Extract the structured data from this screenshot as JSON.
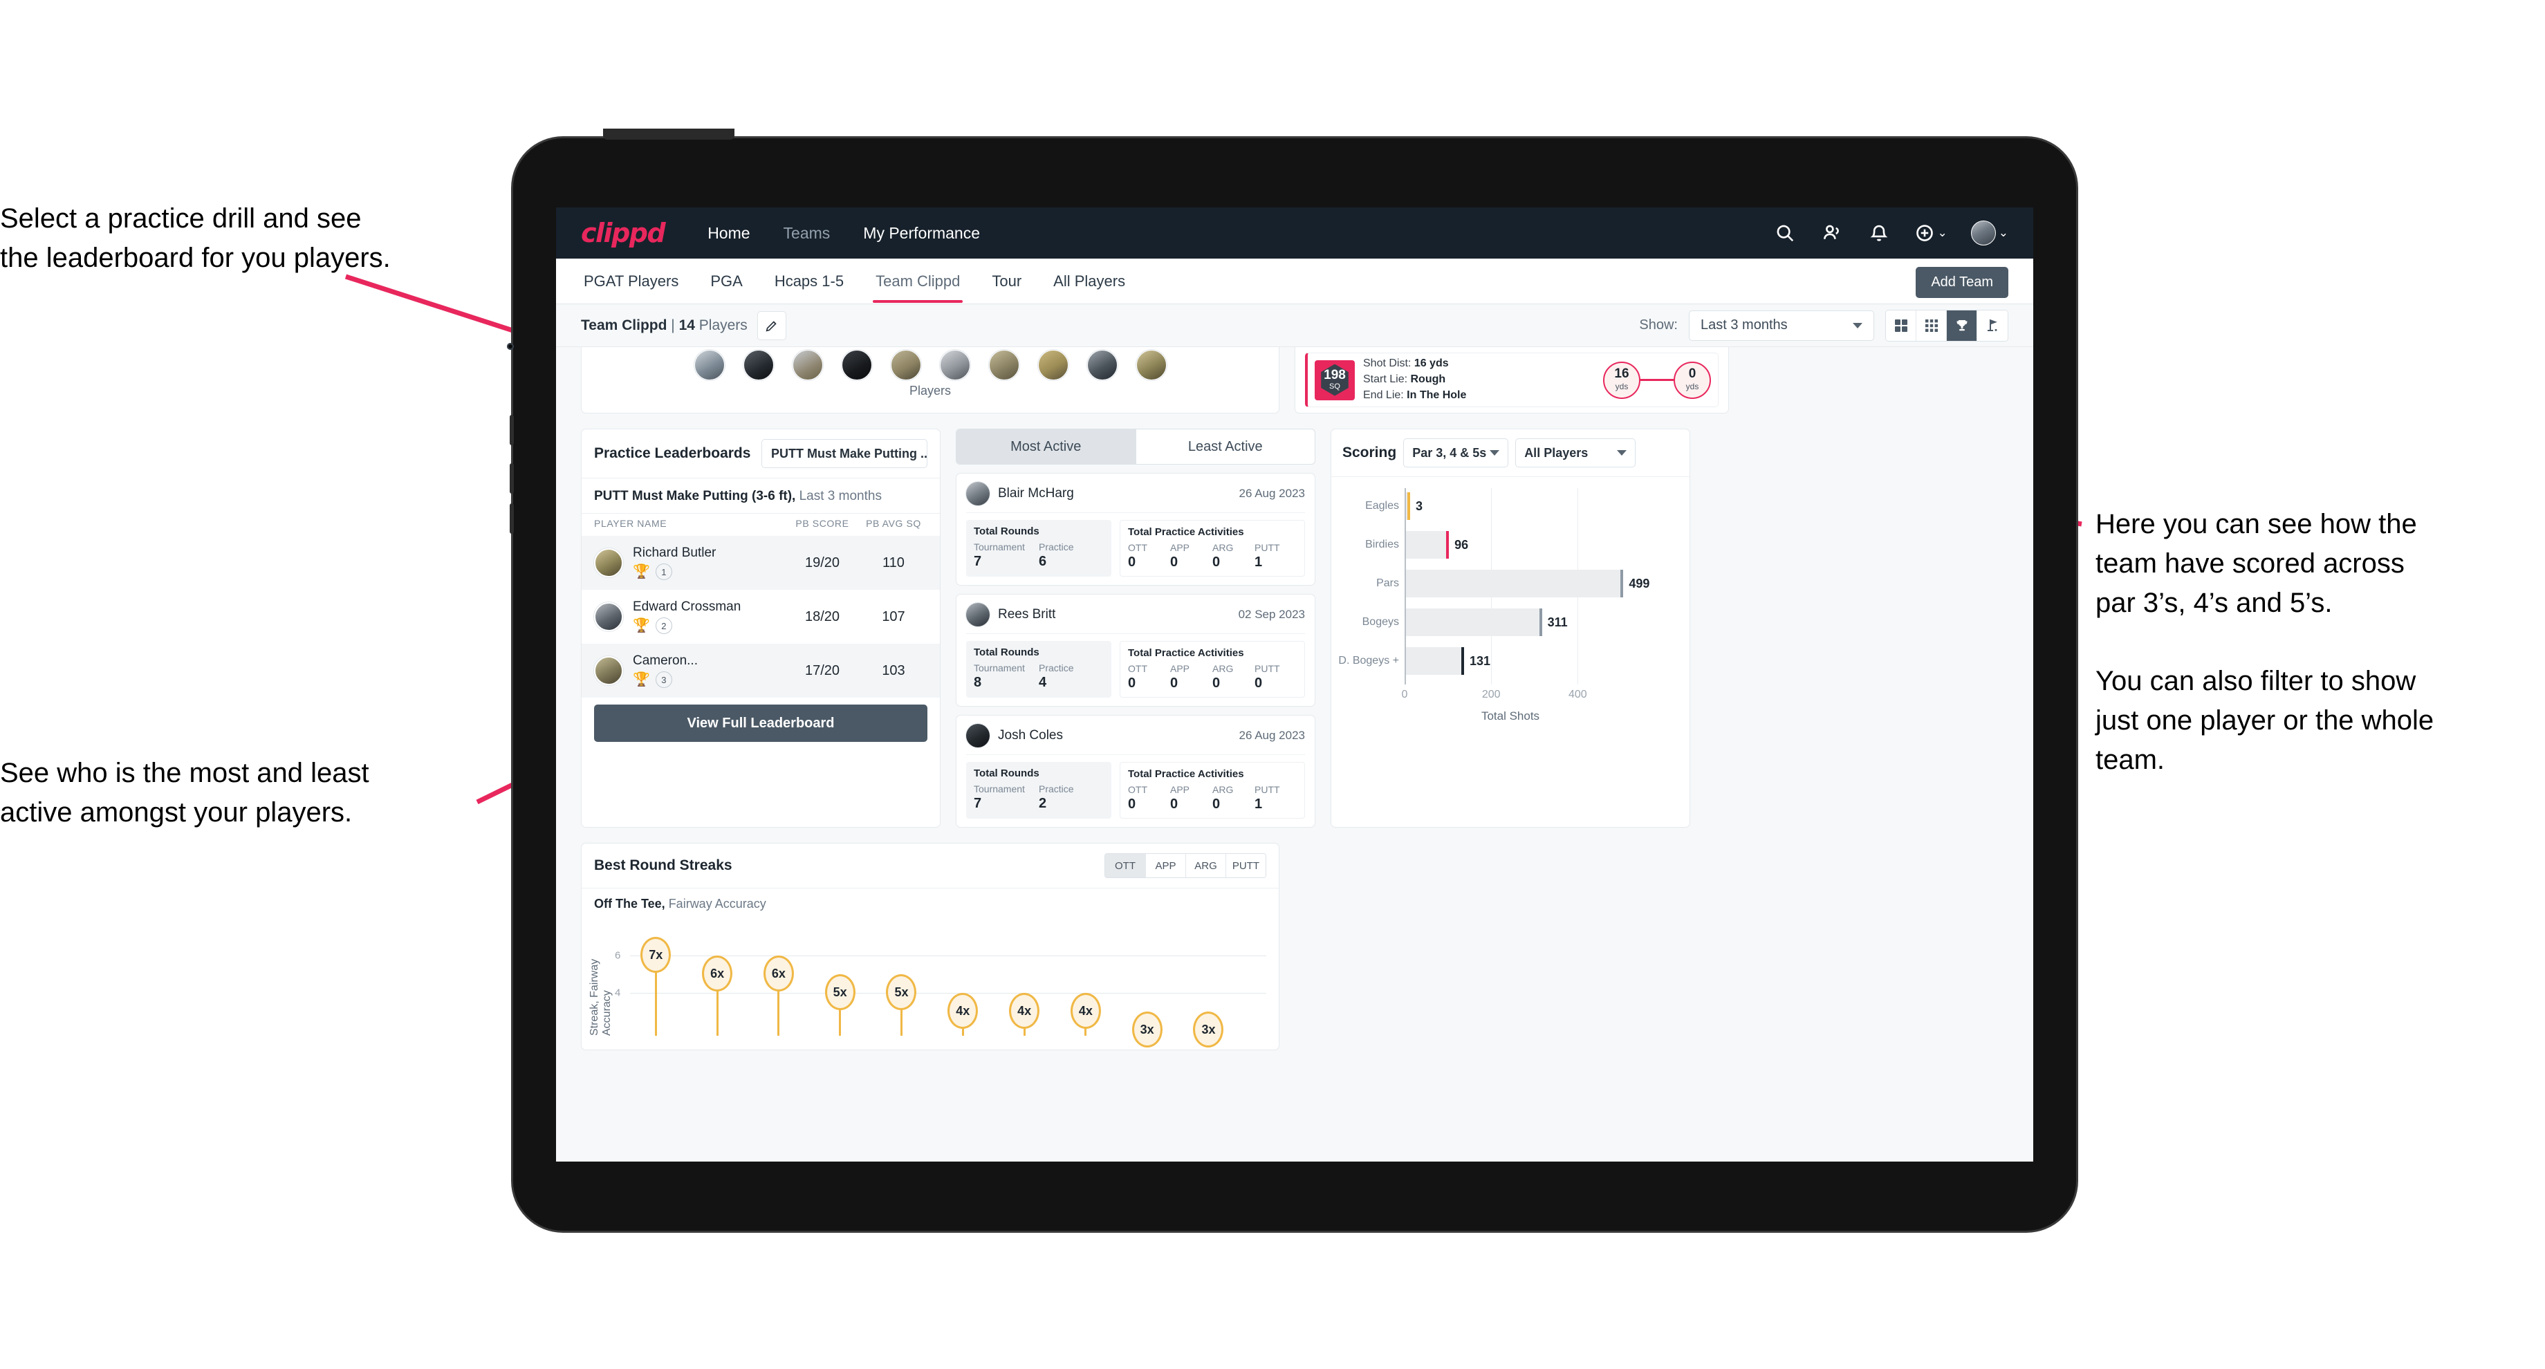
{
  "annotations": {
    "drill": "Select a practice drill and see\nthe leaderboard for you players.",
    "active": "See who is the most and least\nactive amongst your players.",
    "scoring": "Here you can see how the\nteam have scored across\npar 3’s, 4’s and 5’s.\n\nYou can also filter to show\njust one player or the whole\nteam."
  },
  "nav": {
    "logo": "clippd",
    "links": [
      {
        "label": "Home",
        "dim": false
      },
      {
        "label": "Teams",
        "dim": true
      },
      {
        "label": "My Performance",
        "dim": false
      }
    ],
    "icons": [
      "search-icon",
      "people-icon",
      "bell-icon",
      "plus-circle-icon",
      "avatar"
    ]
  },
  "tabs": {
    "items": [
      {
        "label": "PGAT Players",
        "active": false
      },
      {
        "label": "PGA",
        "active": false
      },
      {
        "label": "Hcaps 1-5",
        "active": false
      },
      {
        "label": "Team Clippd",
        "active": true
      },
      {
        "label": "Tour",
        "active": false
      },
      {
        "label": "All Players",
        "active": false
      }
    ],
    "add_team": "Add Team"
  },
  "subheader": {
    "team_name": "Team Clippd",
    "separator": " | ",
    "player_count": "14",
    "players_word": " Players",
    "show_label": "Show:",
    "period": "Last 3 months",
    "view_modes": [
      "grid-icon",
      "dots-grid-icon",
      "trophy-icon",
      "flag-icon"
    ],
    "active_view": "trophy-icon"
  },
  "players_card": {
    "caption": "Players",
    "count": 10
  },
  "shot_card": {
    "sq_value": "198",
    "sq_unit": "SQ",
    "lines": [
      {
        "label": "Shot Dist: ",
        "value": "16 yds"
      },
      {
        "label": "Start Lie: ",
        "value": "Rough"
      },
      {
        "label": "End Lie: ",
        "value": "In The Hole"
      }
    ],
    "start_yds": "16",
    "end_yds": "0",
    "yds_unit": "yds"
  },
  "practice_leaderboards": {
    "title": "Practice Leaderboards",
    "drill_select": "PUTT Must Make Putting ...",
    "subtitle_bold": "PUTT Must Make Putting (3-6 ft),",
    "subtitle_rest": " Last 3 months",
    "columns": [
      "PLAYER NAME",
      "PB SCORE",
      "PB AVG SQ"
    ],
    "rows": [
      {
        "name": "Richard Butler",
        "rank": "1",
        "trophy": "gold",
        "score": "19/20",
        "sq": "110",
        "highlight": true
      },
      {
        "name": "Edward Crossman",
        "rank": "2",
        "trophy": "silver",
        "score": "18/20",
        "sq": "107",
        "highlight": false
      },
      {
        "name": "Cameron...",
        "rank": "3",
        "trophy": "bronze",
        "score": "17/20",
        "sq": "103",
        "highlight": true
      }
    ],
    "view_full": "View Full Leaderboard"
  },
  "activity": {
    "tabs": [
      {
        "label": "Most Active",
        "active": true
      },
      {
        "label": "Least Active",
        "active": false
      }
    ],
    "rounds_title": "Total Rounds",
    "practice_title": "Total Practice Activities",
    "rounds_cols": [
      "Tournament",
      "Practice"
    ],
    "practice_cols": [
      "OTT",
      "APP",
      "ARG",
      "PUTT"
    ],
    "players": [
      {
        "name": "Blair McHarg",
        "date": "26 Aug 2023",
        "tournament": "7",
        "practice": "6",
        "ott": "0",
        "app": "0",
        "arg": "0",
        "putt": "1"
      },
      {
        "name": "Rees Britt",
        "date": "02 Sep 2023",
        "tournament": "8",
        "practice": "4",
        "ott": "0",
        "app": "0",
        "arg": "0",
        "putt": "0"
      },
      {
        "name": "Josh Coles",
        "date": "26 Aug 2023",
        "tournament": "7",
        "practice": "2",
        "ott": "0",
        "app": "0",
        "arg": "0",
        "putt": "1"
      }
    ]
  },
  "scoring": {
    "title": "Scoring",
    "par_select": "Par 3, 4 & 5s",
    "player_select": "All Players"
  },
  "streaks": {
    "title": "Best Round Streaks",
    "toggle": [
      {
        "label": "OTT",
        "active": true
      },
      {
        "label": "APP",
        "active": false
      },
      {
        "label": "ARG",
        "active": false
      },
      {
        "label": "PUTT",
        "active": false
      }
    ],
    "sub_bold": "Off The Tee,",
    "sub_rest": " Fairway Accuracy"
  },
  "chart_data": [
    {
      "type": "bar",
      "orientation": "horizontal",
      "title": "Scoring",
      "categories": [
        "Eagles",
        "Birdies",
        "Pars",
        "Bogeys",
        "D. Bogeys +"
      ],
      "values": [
        3,
        96,
        499,
        311,
        131
      ],
      "colors": [
        "#f0b845",
        "#e8275d",
        "#8e9aa5",
        "#8e9aa5",
        "#1d262f"
      ],
      "xlabel": "Total Shots",
      "ylabel": "",
      "xlim": [
        0,
        540
      ],
      "xticks": [
        0,
        200,
        400
      ],
      "grid": true,
      "legend": "none"
    },
    {
      "type": "bar",
      "variant": "lollipop",
      "title": "Best Round Streaks",
      "subtitle": "Off The Tee, Fairway Accuracy",
      "ylabel": "Streak, Fairway Accuracy",
      "xlabel": "",
      "categories": [
        "p1",
        "p2",
        "p3",
        "p4",
        "p5",
        "p6",
        "p7",
        "p8",
        "p9",
        "p10"
      ],
      "values": [
        7,
        6,
        6,
        5,
        5,
        4,
        4,
        4,
        3,
        3
      ],
      "labels": [
        "7x",
        "6x",
        "6x",
        "5x",
        "5x",
        "4x",
        "4x",
        "4x",
        "3x",
        "3x"
      ],
      "yticks": [
        4,
        6
      ],
      "ylim": [
        0,
        8
      ],
      "grid": true,
      "color": "#f0b845"
    }
  ]
}
